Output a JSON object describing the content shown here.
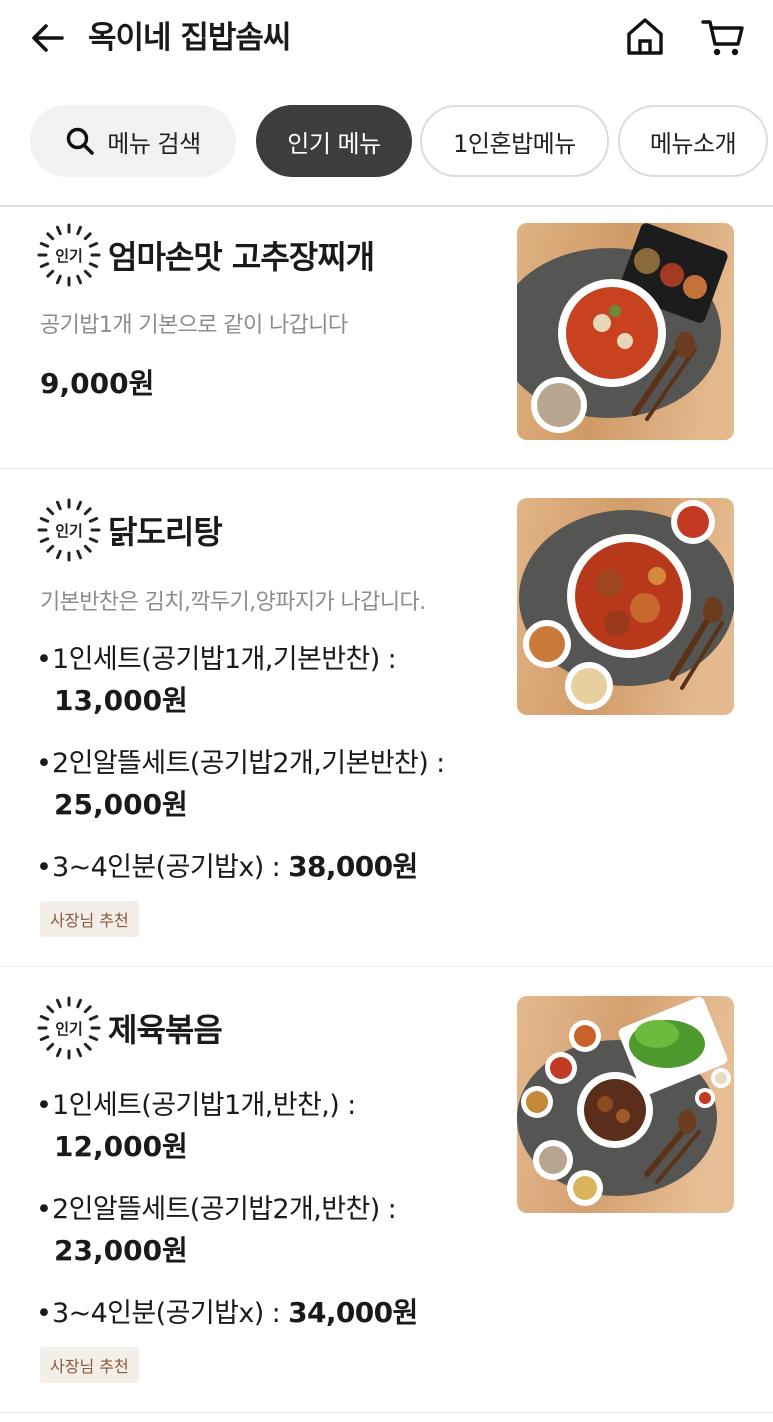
{
  "header": {
    "title": "옥이네 집밥솜씨"
  },
  "chips": {
    "search": "메뉴 검색",
    "popular": "인기 메뉴",
    "solo": "1인혼밥메뉴",
    "intro": "메뉴소개"
  },
  "badge_text": "인기",
  "items": [
    {
      "name": "엄마손맛 고추장찌개",
      "desc": "공기밥1개 기본으로 같이 나갑니다",
      "price": "9,000원"
    },
    {
      "name": "닭도리탕",
      "desc": "기본반찬은 김치,깍두기,양파지가 나갑니다.",
      "options": [
        {
          "text": "1인세트(공기밥1개,기본반찬) :",
          "price": "13,000원"
        },
        {
          "text": "2인알뜰세트(공기밥2개,기본반찬) :",
          "price": "25,000원"
        },
        {
          "text": "3~4인분(공기밥x) : ",
          "price": "38,000원"
        }
      ],
      "tag": "사장님 추천"
    },
    {
      "name": "제육볶음",
      "options": [
        {
          "text": "1인세트(공기밥1개,반찬,) :",
          "price": "12,000원"
        },
        {
          "text": "2인알뜰세트(공기밥2개,반찬) :",
          "price": "23,000원"
        },
        {
          "text": "3~4인분(공기밥x) : ",
          "price": "34,000원"
        }
      ],
      "tag": "사장님 추천"
    }
  ]
}
